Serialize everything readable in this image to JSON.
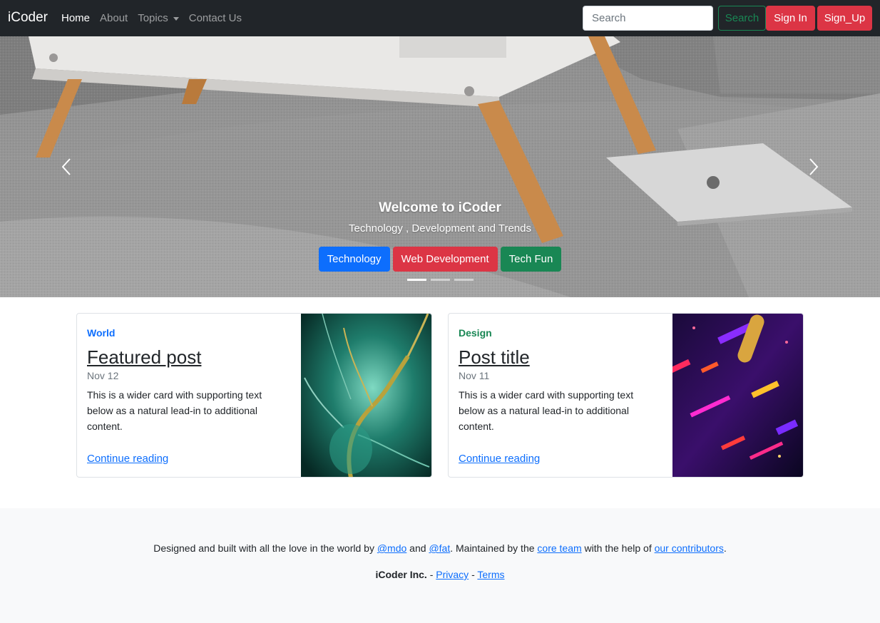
{
  "navbar": {
    "brand": "iCoder",
    "links": [
      {
        "label": "Home",
        "active": true
      },
      {
        "label": "About",
        "active": false
      },
      {
        "label": "Topics",
        "active": false,
        "dropdown": true
      },
      {
        "label": "Contact Us",
        "active": false
      }
    ],
    "search_placeholder": "Search",
    "search_button": "Search",
    "signin_button": "Sign In",
    "signup_button": "Sign_Up"
  },
  "hero": {
    "title": "Welcome to iCoder",
    "subtitle": "Technology , Development and Trends",
    "buttons": [
      "Technology",
      "Web Development",
      "Tech Fun"
    ],
    "indicators": 3,
    "active_indicator": 0
  },
  "cards": [
    {
      "category": "World",
      "title": "Featured post",
      "date": "Nov 12",
      "text": "This is a wider card with supporting text below as a natural lead-in to additional content.",
      "link": "Continue reading"
    },
    {
      "category": "Design",
      "title": "Post title",
      "date": "Nov 11",
      "text": "This is a wider card with supporting text below as a natural lead-in to additional content.",
      "link": "Continue reading"
    }
  ],
  "footer": {
    "line1": {
      "t1": "Designed and built with all the love in the world by ",
      "link1": "@mdo",
      "t2": " and ",
      "link2": "@fat",
      "t3": ". Maintained by the ",
      "link3": "core team",
      "t4": " with the help of ",
      "link4": "our contributors",
      "t5": "."
    },
    "line2": {
      "company": "iCoder Inc.",
      "sep1": " - ",
      "privacy": "Privacy",
      "sep2": " - ",
      "terms": "Terms"
    }
  },
  "colors": {
    "navbar_bg": "#212529",
    "primary": "#0d6efd",
    "danger": "#dc3545",
    "success": "#198754",
    "footer_bg": "#f8f9fa"
  }
}
